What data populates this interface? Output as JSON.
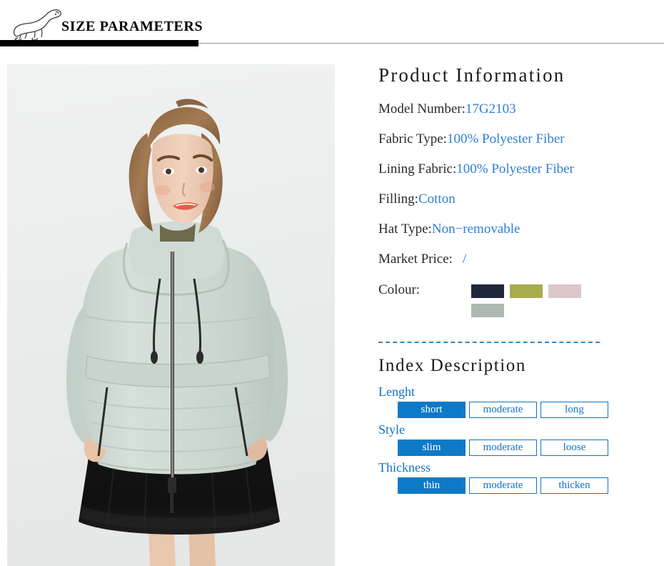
{
  "header": {
    "title": "SIZE PARAMETERS",
    "logo_icon": "polar-bear-logo-icon"
  },
  "photo": {
    "alt": "Female model wearing mint green hooded puffer jacket with black mesh skirt",
    "jacket_color": "#cdd8d2",
    "skirt_color": "#121212",
    "background_color": "#eceeed"
  },
  "product_information": {
    "title": "Product Information",
    "rows": [
      {
        "label": "Model Number:",
        "value": "17G2103"
      },
      {
        "label": "Fabric Type:",
        "value": "100% Polyester Fiber"
      },
      {
        "label": "Lining Fabric:",
        "value": "100% Polyester Fiber"
      },
      {
        "label": "Filling:",
        "value": "Cotton"
      },
      {
        "label": "Hat Type:",
        "value": "Non−removable"
      }
    ],
    "market_price": {
      "label": "Market Price:",
      "value": "/"
    },
    "colour": {
      "label": "Colour:",
      "swatches": [
        {
          "name": "navy",
          "hex": "#20273a"
        },
        {
          "name": "olive-green",
          "hex": "#a8ac4c"
        },
        {
          "name": "dusty-pink",
          "hex": "#dcc7cb"
        },
        {
          "name": "sage-gray",
          "hex": "#adb8b0"
        }
      ]
    }
  },
  "index_description": {
    "title": "Index Description",
    "accent_color": "#0d7ac8",
    "groups": [
      {
        "label": "Lenght",
        "options": [
          {
            "text": "short",
            "selected": true
          },
          {
            "text": "moderate",
            "selected": false
          },
          {
            "text": "long",
            "selected": false
          }
        ]
      },
      {
        "label": "Style",
        "options": [
          {
            "text": "slim",
            "selected": true
          },
          {
            "text": "moderate",
            "selected": false
          },
          {
            "text": "loose",
            "selected": false
          }
        ]
      },
      {
        "label": "Thickness",
        "options": [
          {
            "text": "thin",
            "selected": true
          },
          {
            "text": "moderate",
            "selected": false
          },
          {
            "text": "thicken",
            "selected": false
          }
        ]
      }
    ]
  }
}
